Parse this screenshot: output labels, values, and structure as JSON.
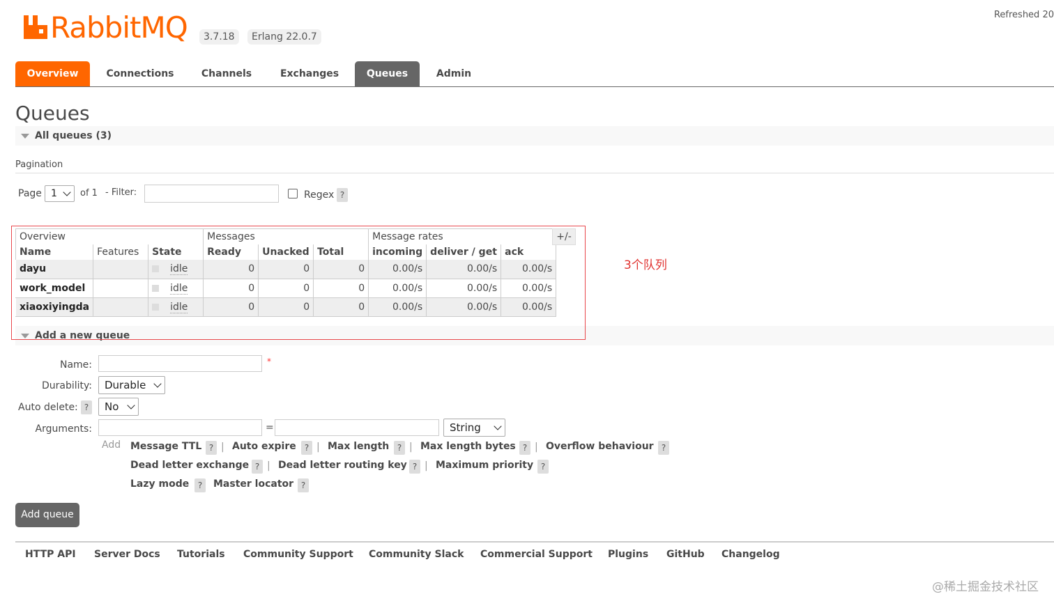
{
  "header": {
    "logo_text": "RabbitMQ",
    "version": "3.7.18",
    "erlang": "Erlang 22.0.7",
    "refreshed": "Refreshed 20"
  },
  "tabs": [
    "Overview",
    "Connections",
    "Channels",
    "Exchanges",
    "Queues",
    "Admin"
  ],
  "page_title": "Queues",
  "all_queues": {
    "label": "All queues (3)"
  },
  "pagination": {
    "section_label": "Pagination",
    "page_label": "Page",
    "page_value": "1",
    "of_label": "of 1",
    "filter_label": "- Filter:",
    "filter_value": "",
    "regex_label": "Regex",
    "help": "?"
  },
  "table": {
    "groups": [
      "Overview",
      "Messages",
      "Message rates"
    ],
    "toggle": "+/-",
    "columns": [
      "Name",
      "Features",
      "State",
      "Ready",
      "Unacked",
      "Total",
      "incoming",
      "deliver / get",
      "ack"
    ],
    "rows": [
      {
        "name": "dayu",
        "features": "",
        "state": "idle",
        "ready": "0",
        "unacked": "0",
        "total": "0",
        "incoming": "0.00/s",
        "deliver_get": "0.00/s",
        "ack": "0.00/s"
      },
      {
        "name": "work_model",
        "features": "",
        "state": "idle",
        "ready": "0",
        "unacked": "0",
        "total": "0",
        "incoming": "0.00/s",
        "deliver_get": "0.00/s",
        "ack": "0.00/s"
      },
      {
        "name": "xiaoxiyingda",
        "features": "",
        "state": "idle",
        "ready": "0",
        "unacked": "0",
        "total": "0",
        "incoming": "0.00/s",
        "deliver_get": "0.00/s",
        "ack": "0.00/s"
      }
    ]
  },
  "annotation": "3个队列",
  "add_queue": {
    "section_label": "Add a new queue",
    "name_label": "Name:",
    "name_value": "",
    "required_mark": "*",
    "durability_label": "Durability:",
    "durability_value": "Durable",
    "auto_delete_label": "Auto delete:",
    "auto_delete_value": "No",
    "arguments_label": "Arguments:",
    "equals": "=",
    "arg_type": "String",
    "add_label": "Add",
    "options": [
      "Message TTL",
      "Auto expire",
      "Max length",
      "Max length bytes",
      "Overflow behaviour",
      "Dead letter exchange",
      "Dead letter routing key",
      "Maximum priority",
      "Lazy mode",
      "Master locator"
    ],
    "separator": "|",
    "help": "?",
    "submit_label": "Add queue"
  },
  "footer": [
    "HTTP API",
    "Server Docs",
    "Tutorials",
    "Community Support",
    "Community Slack",
    "Commercial Support",
    "Plugins",
    "GitHub",
    "Changelog"
  ],
  "watermark": "@稀土掘金技术社区",
  "colors": {
    "brand_orange": "#ff6600",
    "tab_active_grey": "#666666",
    "annotation_red": "#e0322f"
  }
}
